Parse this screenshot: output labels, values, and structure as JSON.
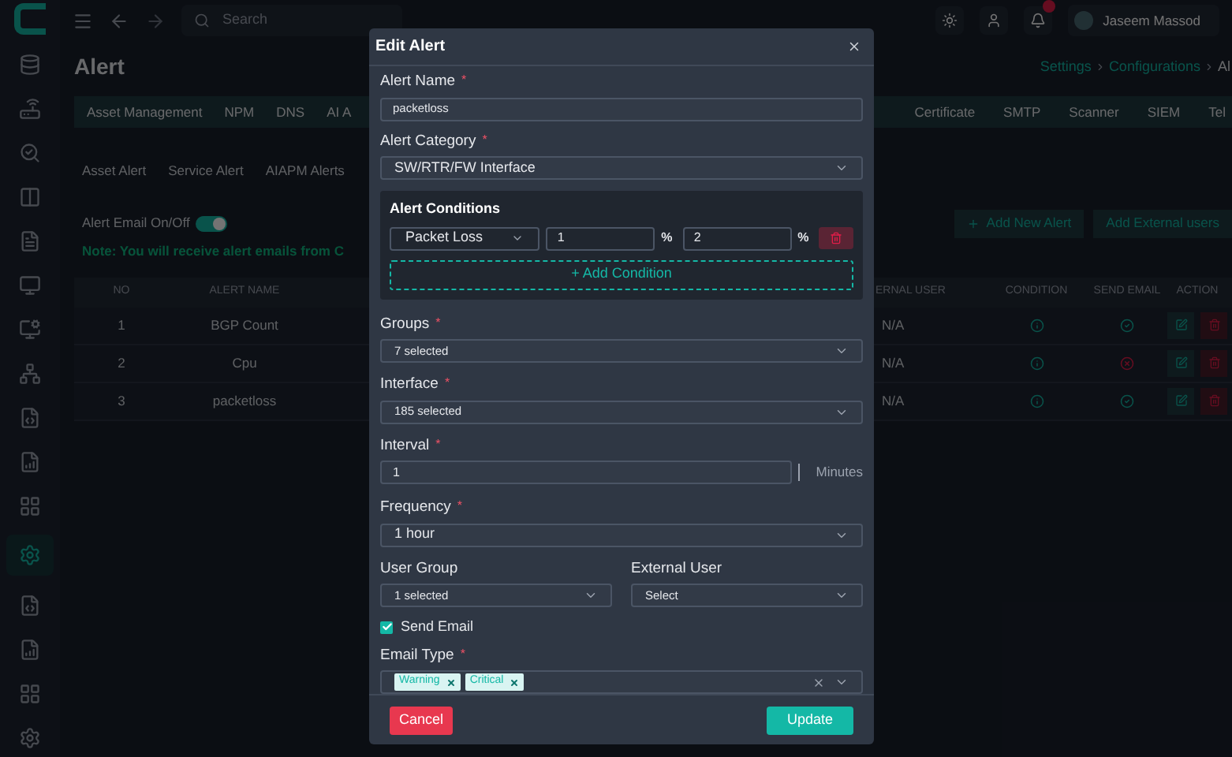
{
  "sidebar": [
    {
      "selected": false
    },
    {
      "selected": false
    },
    {
      "selected": false
    },
    {
      "selected": false
    },
    {
      "selected": false
    },
    {
      "selected": false
    },
    {
      "selected": false
    },
    {
      "selected": false
    },
    {
      "selected": false
    },
    {
      "selected": false
    },
    {
      "selected": false
    },
    {
      "selected": true
    },
    {
      "selected": false
    },
    {
      "selected": false
    },
    {
      "selected": false
    },
    {
      "selected": false
    }
  ],
  "topbar": {
    "search_placeholder": "Search",
    "user": "Jaseem Massod"
  },
  "page": {
    "title": "Alert",
    "breadcrumb": [
      "Settings",
      "Configurations",
      "Al"
    ]
  },
  "module_tabs_left": [
    "Asset Management",
    "NPM",
    "DNS",
    "AI A"
  ],
  "module_tabs_right": [
    "Certificate",
    "SMTP",
    "Scanner",
    "SIEM",
    "Tel"
  ],
  "alert_tabs": [
    "Asset Alert",
    "Service Alert",
    "AIAPM Alerts"
  ],
  "email_toggle": {
    "label": "Alert Email On/Off",
    "on": true
  },
  "note": "Note: You will receive alert emails from C",
  "actions": {
    "add_alert": "Add New Alert",
    "add_external": "Add External users"
  },
  "table": {
    "columns": [
      "NO",
      "ALERT NAME",
      "ERNAL USER",
      "CONDITION",
      "SEND EMAIL",
      "ACTION"
    ],
    "rows": [
      {
        "no": "1",
        "name": "BGP Count",
        "external_user": "N/A",
        "send_email": true
      },
      {
        "no": "2",
        "name": "Cpu",
        "external_user": "N/A",
        "send_email": false
      },
      {
        "no": "3",
        "name": "packetloss",
        "external_user": "N/A",
        "send_email": true
      }
    ]
  },
  "modal": {
    "title": "Edit Alert",
    "alert_name": {
      "label": "Alert Name",
      "required_mark": "*",
      "value": "packetloss"
    },
    "alert_category": {
      "label": "Alert Category",
      "required_mark": "*",
      "value": "SW/RTR/FW Interface"
    },
    "conditions": {
      "title": "Alert Conditions",
      "rows": [
        {
          "metric": "Packet Loss",
          "value_1": "1",
          "unit_1": "%",
          "value_2": "2",
          "unit_2": "%"
        }
      ],
      "add_label": "+ Add Condition"
    },
    "groups": {
      "label": "Groups",
      "required_mark": "*",
      "value": "7 selected"
    },
    "interface": {
      "label": "Interface",
      "required_mark": "*",
      "value": "185 selected"
    },
    "interval": {
      "label": "Interval",
      "required_mark": "*",
      "value": "1",
      "unit": "Minutes"
    },
    "frequency": {
      "label": "Frequency",
      "required_mark": "*",
      "value": "1 hour"
    },
    "user_group": {
      "label": "User Group",
      "value": "1 selected"
    },
    "external_user": {
      "label": "External User",
      "placeholder": "Select"
    },
    "send_email": {
      "label": "Send Email",
      "checked": true
    },
    "email_type": {
      "label": "Email Type",
      "required_mark": "*",
      "tags": [
        "Warning",
        "Critical"
      ]
    },
    "cancel": "Cancel",
    "update": "Update"
  }
}
